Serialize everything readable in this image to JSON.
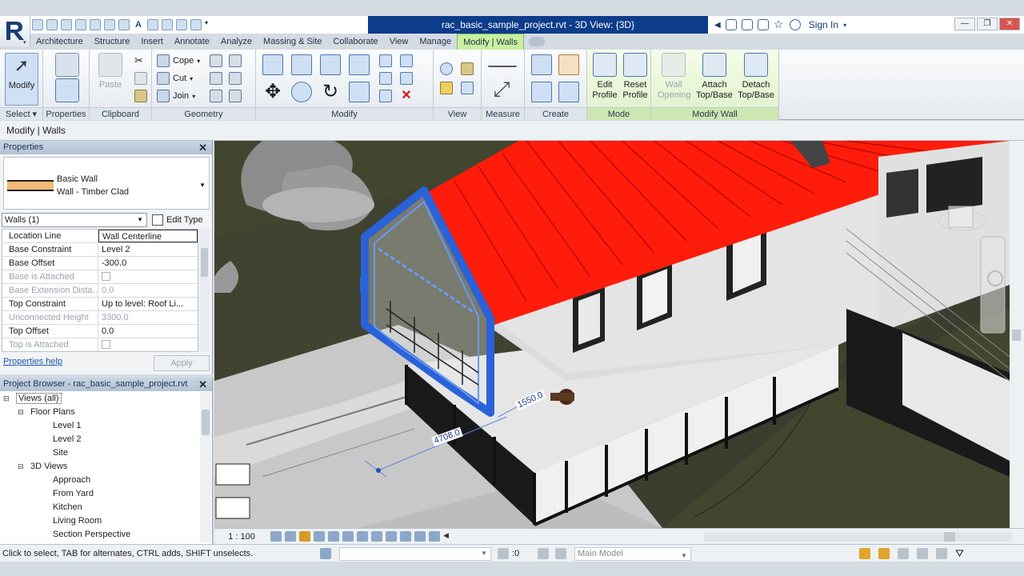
{
  "title": {
    "document": "rac_basic_sample_project.rvt - 3D View: {3D}",
    "sign_in": "Sign In"
  },
  "icons": [
    "revit-logo-icon",
    "open-icon",
    "save-icon",
    "undo-icon",
    "redo-icon",
    "measure-icon",
    "text-icon",
    "search-icon",
    "help-icon",
    "star-icon",
    "user-icon",
    "close-icon",
    "cursor-icon"
  ],
  "colors": {
    "context_tab": "#c8f0a0",
    "doc_band": "#0c3c8a",
    "roof": "#ff1c0a",
    "selection": "#2a62d8"
  },
  "tabs": [
    "Architecture",
    "Structure",
    "Insert",
    "Annotate",
    "Analyze",
    "Massing & Site",
    "Collaborate",
    "View",
    "Manage",
    "Modify | Walls"
  ],
  "ribbon": {
    "select": {
      "modify": "Modify",
      "label": "Select ▾"
    },
    "properties": {
      "label": "Properties"
    },
    "clipboard": {
      "paste": "Paste",
      "label": "Clipboard"
    },
    "geometry": {
      "cope": "Cope",
      "cut": "Cut",
      "join": "Join",
      "label": "Geometry"
    },
    "modify": {
      "label": "Modify"
    },
    "view": {
      "label": "View"
    },
    "measure": {
      "label": "Measure"
    },
    "create": {
      "label": "Create"
    },
    "mode": {
      "edit_profile_1": "Edit",
      "edit_profile_2": "Profile",
      "reset_profile_1": "Reset",
      "reset_profile_2": "Profile",
      "label": "Mode"
    },
    "modify_wall": {
      "wall_opening_1": "Wall",
      "wall_opening_2": "Opening",
      "attach_1": "Attach",
      "attach_2": "Top/Base",
      "detach_1": "Detach",
      "detach_2": "Top/Base",
      "label": "Modify Wall"
    }
  },
  "options_bar": "Modify | Walls",
  "properties": {
    "title": "Properties",
    "type_family": "Basic Wall",
    "type_name": "Wall - Timber Clad",
    "filter": "Walls (1)",
    "edit_type": "Edit Type",
    "rows": [
      {
        "key": "Location Line",
        "value": "Wall Centerline",
        "state": "sel"
      },
      {
        "key": "Base Constraint",
        "value": "Level 2",
        "state": ""
      },
      {
        "key": "Base Offset",
        "value": "-300.0",
        "state": ""
      },
      {
        "key": "Base is Attached",
        "value": "",
        "state": "dis"
      },
      {
        "key": "Base Extension Dista...",
        "value": "0.0",
        "state": "dis"
      },
      {
        "key": "Top Constraint",
        "value": "Up to level: Roof Li...",
        "state": ""
      },
      {
        "key": "Unconnected Height",
        "value": "3300.0",
        "state": "dis"
      },
      {
        "key": "Top Offset",
        "value": "0.0",
        "state": ""
      },
      {
        "key": "Top is Attached",
        "value": "",
        "state": "dis"
      }
    ],
    "help": "Properties help",
    "apply": "Apply"
  },
  "browser": {
    "title": "Project Browser - rac_basic_sample_project.rvt",
    "nodes": [
      {
        "label": "Views (all)",
        "level": 0,
        "toggle": "⊟"
      },
      {
        "label": "Floor Plans",
        "level": 1,
        "toggle": "⊟"
      },
      {
        "label": "Level 1",
        "level": 2,
        "toggle": ""
      },
      {
        "label": "Level 2",
        "level": 2,
        "toggle": ""
      },
      {
        "label": "Site",
        "level": 2,
        "toggle": ""
      },
      {
        "label": "3D Views",
        "level": 1,
        "toggle": "⊟"
      },
      {
        "label": "Approach",
        "level": 2,
        "toggle": ""
      },
      {
        "label": "From Yard",
        "level": 2,
        "toggle": ""
      },
      {
        "label": "Kitchen",
        "level": 2,
        "toggle": ""
      },
      {
        "label": "Living Room",
        "level": 2,
        "toggle": ""
      },
      {
        "label": "Section Perspective",
        "level": 2,
        "toggle": ""
      }
    ]
  },
  "view": {
    "dim1": "4708.0",
    "dim2": "1550.0"
  },
  "view_control": {
    "scale": "1 : 100"
  },
  "status": {
    "message": "Click to select, TAB for alternates, CTRL adds, SHIFT unselects.",
    "selected": ":0",
    "model": "Main Model"
  }
}
